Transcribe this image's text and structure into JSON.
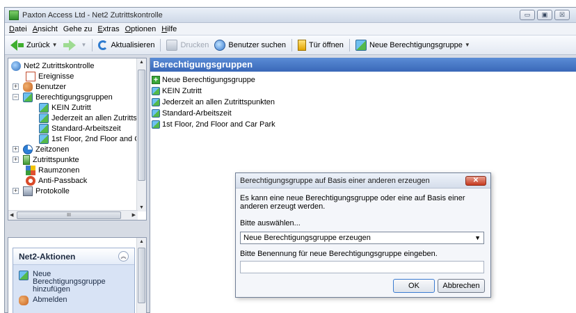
{
  "window": {
    "title": "Paxton Access Ltd - Net2 Zutrittskontrolle",
    "controls": [
      "▭",
      "▣",
      "☒"
    ]
  },
  "menu": [
    {
      "mn": "D",
      "rest": "atei"
    },
    {
      "mn": "A",
      "rest": "nsicht"
    },
    {
      "mn": "",
      "rest": "Gehe zu"
    },
    {
      "mn": "E",
      "rest": "xtras",
      "pre": "E"
    },
    {
      "mn": "O",
      "rest": "ptionen"
    },
    {
      "mn": "H",
      "rest": "ilfe"
    }
  ],
  "toolbar": {
    "back": "Zurück",
    "refresh": "Aktualisieren",
    "print": "Drucken",
    "search_users": "Benutzer suchen",
    "open_door": "Tür öffnen",
    "new_group": "Neue Berechtigungsgruppe"
  },
  "tree": {
    "root": "Net2 Zutrittskontrolle",
    "events": "Ereignisse",
    "users": "Benutzer",
    "groups": "Berechtigungsgruppen",
    "group_children": [
      "KEIN Zutritt",
      "Jederzeit an allen Zutritts",
      "Standard-Arbeitszeit",
      "1st Floor, 2nd Floor and C"
    ],
    "timezones": "Zeitzonen",
    "doorpoints": "Zutrittspunkte",
    "roomzones": "Raumzonen",
    "antipassback": "Anti-Passback",
    "logs": "Protokolle",
    "hscroll_grip": "III"
  },
  "actions": {
    "title": "Net2-Aktionen",
    "add_group": "Neue Berechtigungsgruppe hinzufügen",
    "logout": "Abmelden"
  },
  "content": {
    "title": "Berechtigungsgruppen",
    "items": [
      "Neue Berechtigungsgruppe",
      "KEIN Zutritt",
      "Jederzeit an allen Zutrittspunkten",
      "Standard-Arbeitszeit",
      "1st Floor, 2nd Floor and Car Park"
    ]
  },
  "dialog": {
    "title": "Berechtigungsgruppe auf Basis einer anderen erzeugen",
    "description": "Es kann eine neue Berechtigungsgruppe oder eine auf Basis einer anderen erzeugt werden.",
    "select_label": "Bitte auswählen...",
    "select_value": "Neue Berechtigungsgruppe erzeugen",
    "name_label": "Bitte Benennung für neue Berechtigungsgruppe eingeben.",
    "name_value": "",
    "ok": "OK",
    "cancel": "Abbrechen"
  }
}
